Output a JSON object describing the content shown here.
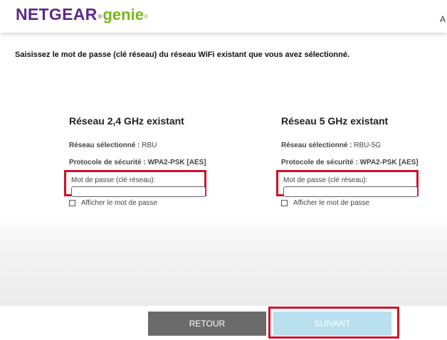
{
  "header": {
    "brand_main": "NETGEAR",
    "brand_reg": "®",
    "brand_sub": "genie",
    "brand_tm": "®",
    "cut_text": "A"
  },
  "instruction": "Saisissez le mot de passe (clé réseau) du réseau WiFi existant que vous avez sélectionné.",
  "networks": [
    {
      "title": "Réseau 2,4 GHz existant",
      "selected_label": "Réseau sélectionné :",
      "selected_value": "RBU",
      "security_label": "Protocole de sécurité :",
      "security_value": "WPA2-PSK [AES]",
      "password_label": "Mot de passe (clé réseau):",
      "password_value": "",
      "show_password_label": "Afficher le mot de passe",
      "show_password_checked": false
    },
    {
      "title": "Réseau 5 GHz existant",
      "selected_label": "Réseau sélectionné :",
      "selected_value": "RBU-5G",
      "security_label": "Protocole de sécurité :",
      "security_value": "WPA2-PSK [AES]",
      "password_label": "Mot de passe (clé réseau):",
      "password_value": "",
      "show_password_label": "Afficher le mot de passe",
      "show_password_checked": false
    }
  ],
  "buttons": {
    "back_label": "RETOUR",
    "next_label": "SUIVANT"
  },
  "colors": {
    "brand_purple": "#5a2a8a",
    "brand_green": "#7ab51d",
    "highlight_red": "#d0112b",
    "back_button": "#6b6b6b",
    "next_button_disabled": "#b8e0ee"
  }
}
